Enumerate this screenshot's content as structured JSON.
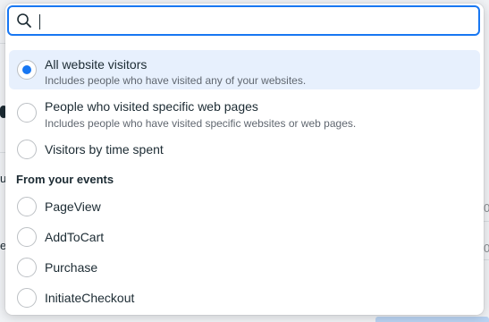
{
  "search": {
    "value": "",
    "placeholder": ""
  },
  "options": [
    {
      "title": "All website visitors",
      "description": "Includes people who have visited any of your websites.",
      "selected": true
    },
    {
      "title": "People who visited specific web pages",
      "description": "Includes people who have visited specific websites or web pages.",
      "selected": false
    },
    {
      "title": "Visitors by time spent",
      "selected": false
    }
  ],
  "events_section": {
    "header": "From your events",
    "items": [
      {
        "title": "PageView",
        "selected": false
      },
      {
        "title": "AddToCart",
        "selected": false
      },
      {
        "title": "Purchase",
        "selected": false
      },
      {
        "title": "InitiateCheckout",
        "selected": false
      }
    ]
  },
  "background_fragments": {
    "left_1": "u",
    "left_2": "e",
    "right_1": "0",
    "right_2": "0"
  },
  "colors": {
    "accent": "#1877f2",
    "selected_bg": "#e7f0fd",
    "text": "#1c2b33",
    "muted": "#606770"
  }
}
